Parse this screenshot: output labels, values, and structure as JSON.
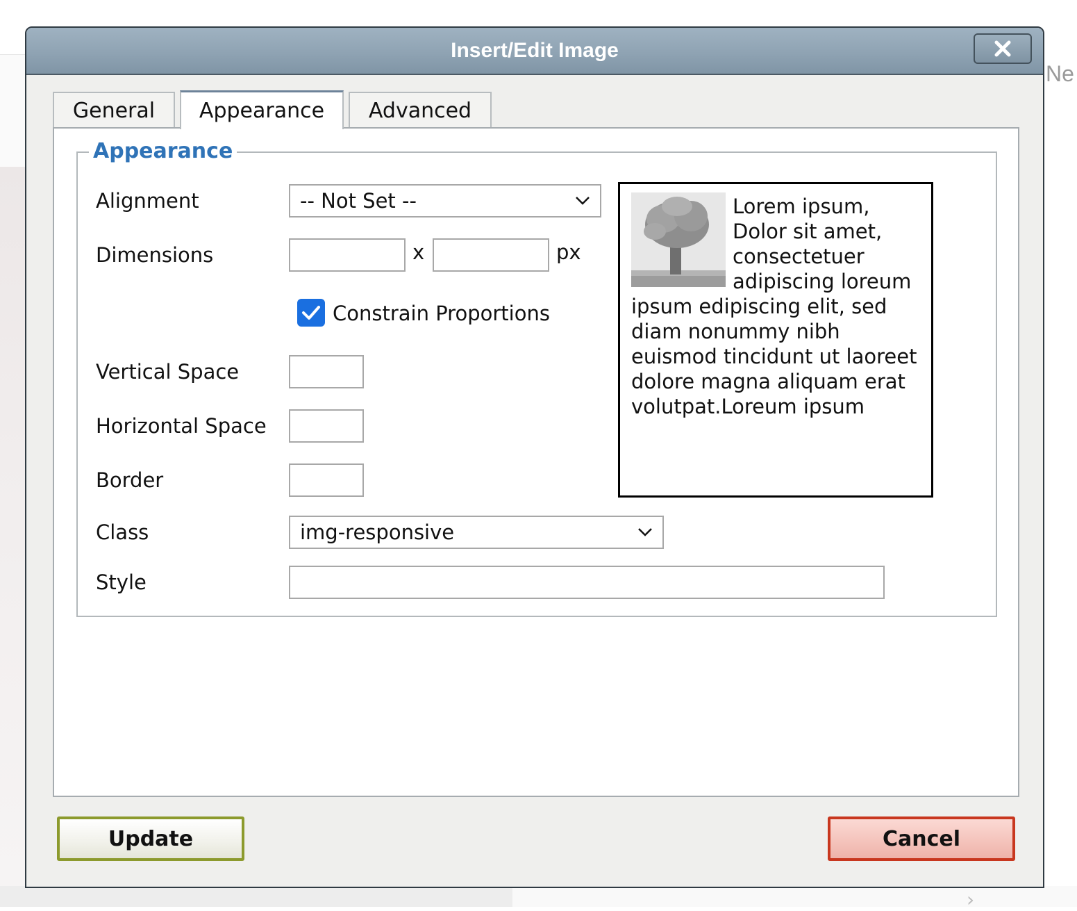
{
  "background": {
    "edge_text": "Ne"
  },
  "dialog": {
    "title": "Insert/Edit Image",
    "tabs": [
      {
        "label": "General",
        "active": false
      },
      {
        "label": "Appearance",
        "active": true
      },
      {
        "label": "Advanced",
        "active": false
      }
    ],
    "fieldset_legend": "Appearance",
    "fields": {
      "alignment": {
        "label": "Alignment",
        "selected": "-- Not Set --"
      },
      "dimensions": {
        "label": "Dimensions",
        "width": "",
        "height": "",
        "separator": "x",
        "unit": "px"
      },
      "constrain": {
        "label": "Constrain Proportions",
        "checked": true
      },
      "vertical_space": {
        "label": "Vertical Space",
        "value": ""
      },
      "horizontal_space": {
        "label": "Horizontal Space",
        "value": ""
      },
      "border": {
        "label": "Border",
        "value": ""
      },
      "class": {
        "label": "Class",
        "selected": "img-responsive"
      },
      "style": {
        "label": "Style",
        "value": ""
      }
    },
    "preview_text": "Lorem ipsum, Dolor sit amet, consectetuer adipiscing loreum ipsum edipiscing elit, sed diam nonummy nibh euismod tincidunt ut laoreet dolore magna aliquam erat volutpat.Loreum ipsum",
    "buttons": {
      "update": "Update",
      "cancel": "Cancel"
    }
  },
  "colors": {
    "accent_legend": "#2f73b7",
    "checkbox": "#1a6fe0",
    "update_border": "#8c9a2d",
    "cancel_border": "#c8371f"
  },
  "icons": {
    "close": "close-icon",
    "dropdown": "chevron-down-icon",
    "check": "check-icon",
    "preview_image": "tree-image"
  }
}
